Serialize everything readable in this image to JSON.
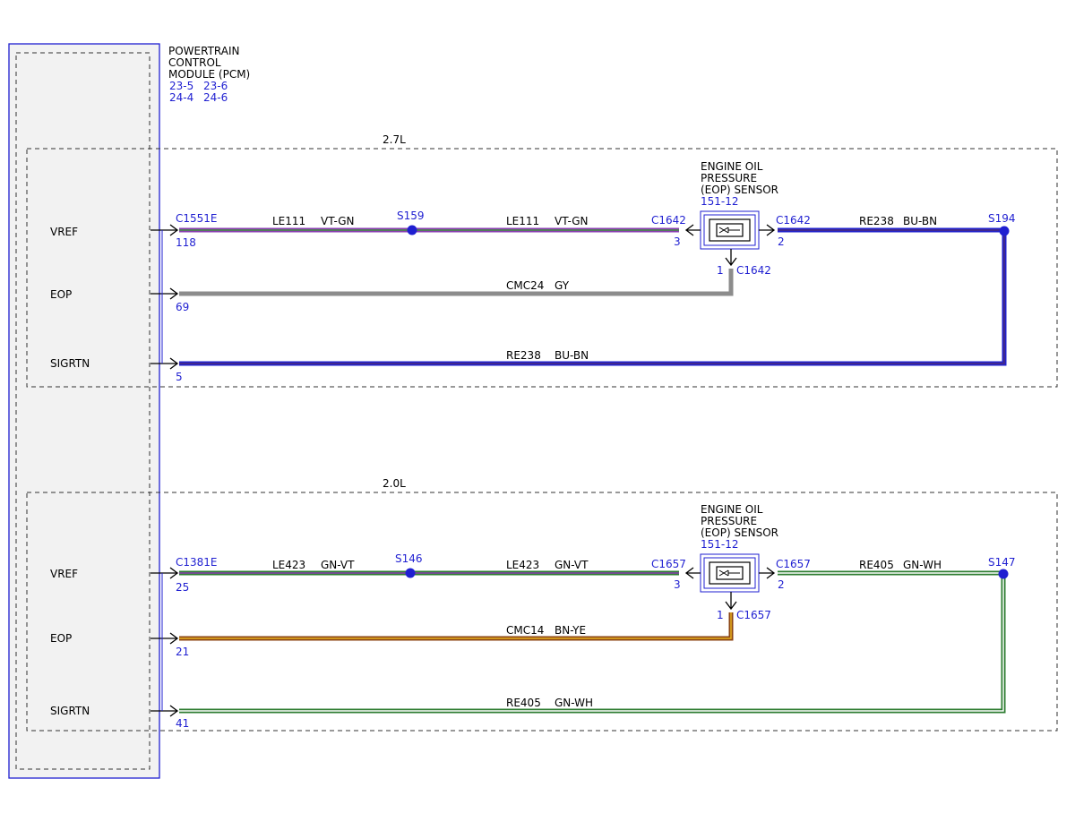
{
  "pcm": {
    "title_lines": [
      "POWERTRAIN",
      "CONTROL",
      "MODULE (PCM)"
    ],
    "refs": [
      "23-5",
      "23-6",
      "24-4",
      "24-6"
    ]
  },
  "variants": [
    {
      "label": "2.7L",
      "pins": [
        {
          "name": "VREF",
          "connector": "C1551E",
          "pin": "118"
        },
        {
          "name": "EOP",
          "pin": "69"
        },
        {
          "name": "SIGRTN",
          "pin": "5"
        }
      ],
      "wires": {
        "vref_a": {
          "circuit": "LE111",
          "color_code": "VT-GN",
          "base": "#8a3fb0",
          "stripe": "#3f8f3f"
        },
        "vref_b": {
          "circuit": "LE111",
          "color_code": "VT-GN",
          "base": "#8a3fb0",
          "stripe": "#3f8f3f"
        },
        "eop": {
          "circuit": "CMC24",
          "color_code": "GY",
          "base": "#8c8c8c",
          "stripe": "#8c8c8c"
        },
        "sigrtn_sensor": {
          "circuit": "RE238",
          "color_code": "BU-BN",
          "base": "#2222cc",
          "stripe": "#4a2a7a"
        },
        "sigrtn": {
          "circuit": "RE238",
          "color_code": "BU-BN",
          "base": "#2222cc",
          "stripe": "#4a2a7a"
        }
      },
      "splice_vref": "S159",
      "splice_return": "S194",
      "sensor": {
        "title_lines": [
          "ENGINE OIL",
          "PRESSURE",
          "(EOP) SENSOR"
        ],
        "ref": "151-12",
        "connector": "C1642",
        "pin_vref": "3",
        "pin_return": "2",
        "pin_signal": "1"
      }
    },
    {
      "label": "2.0L",
      "pins": [
        {
          "name": "VREF",
          "connector": "C1381E",
          "pin": "25"
        },
        {
          "name": "EOP",
          "pin": "21"
        },
        {
          "name": "SIGRTN",
          "pin": "41"
        }
      ],
      "wires": {
        "vref_a": {
          "circuit": "LE423",
          "color_code": "GN-VT",
          "base": "#2e7d32",
          "stripe": "#8a3fb0"
        },
        "vref_b": {
          "circuit": "LE423",
          "color_code": "GN-VT",
          "base": "#2e7d32",
          "stripe": "#8a3fb0"
        },
        "eop": {
          "circuit": "CMC14",
          "color_code": "BN-YE",
          "base": "#8b4513",
          "stripe": "#e8b020"
        },
        "sigrtn_sensor": {
          "circuit": "RE405",
          "color_code": "GN-WH",
          "base": "#2e7d32",
          "stripe": "#ffffff"
        },
        "sigrtn": {
          "circuit": "RE405",
          "color_code": "GN-WH",
          "base": "#2e7d32",
          "stripe": "#ffffff"
        }
      },
      "splice_vref": "S146",
      "splice_return": "S147",
      "sensor": {
        "title_lines": [
          "ENGINE OIL",
          "PRESSURE",
          "(EOP) SENSOR"
        ],
        "ref": "151-12",
        "connector": "C1657",
        "pin_vref": "3",
        "pin_return": "2",
        "pin_signal": "1"
      }
    }
  ],
  "colors": {
    "module_border": "#1f1fd1",
    "module_fill": "#f2f2f2",
    "ref_text": "#1f1fd1",
    "splice": "#1f1fd1"
  }
}
